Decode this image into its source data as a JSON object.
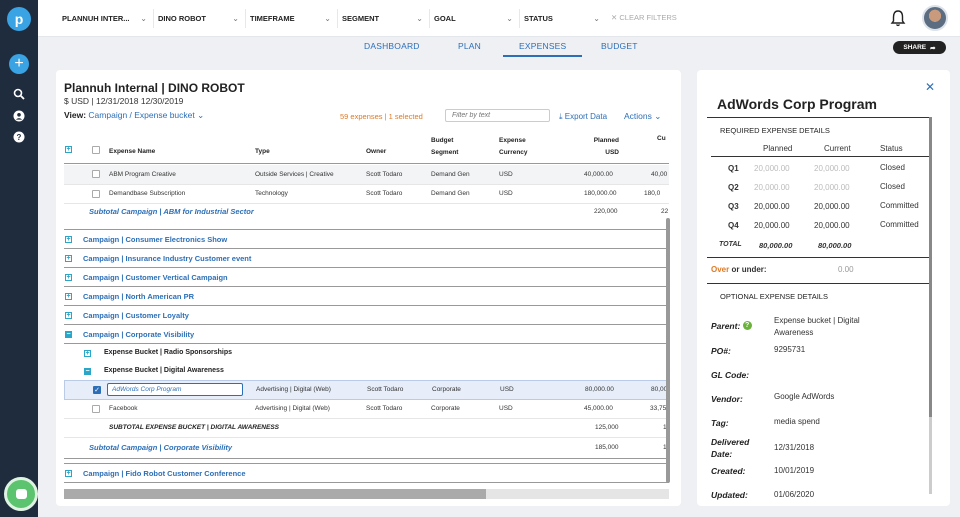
{
  "filters": [
    {
      "label": "PLANNUH INTER..."
    },
    {
      "label": "DINO ROBOT"
    },
    {
      "label": "TIMEFRAME"
    },
    {
      "label": "SEGMENT"
    },
    {
      "label": "GOAL"
    },
    {
      "label": "STATUS"
    }
  ],
  "clear_filters": "✕ CLEAR FILTERS",
  "tabs": [
    "DASHBOARD",
    "PLAN",
    "EXPENSES",
    "BUDGET"
  ],
  "active_tab": "EXPENSES",
  "share": "SHARE",
  "main": {
    "title": "Plannuh Internal | DINO ROBOT",
    "subtitle": "$ USD | 12/31/2018 12/30/2019",
    "view_label": "View:",
    "view_value": "Campaign / Expense bucket",
    "count": "59 expenses | 1 selected",
    "filter_placeholder": "Filter by text",
    "export": "Export Data",
    "actions": "Actions"
  },
  "columns": {
    "name": "Expense Name",
    "type": "Type",
    "owner": "Owner",
    "segment": "Budget Segment",
    "currency": "Expense Currency",
    "planned": "Planned USD",
    "cur": "Cu"
  },
  "rows": {
    "r1": {
      "name": "ABM Program Creative",
      "type": "Outside Services | Creative",
      "owner": "Scott Todaro",
      "segment": "Demand Gen",
      "currency": "USD",
      "planned": "40,000.00",
      "cur": "40,00"
    },
    "r2": {
      "name": "Demandbase Subscription",
      "type": "Technology",
      "owner": "Scott Todaro",
      "segment": "Demand Gen",
      "currency": "USD",
      "planned": "180,000.00",
      "cur": "180,0"
    },
    "sub1": {
      "label": "Subtotal Campaign | ABM for Industrial Sector",
      "planned": "220,000",
      "cur": "22"
    },
    "c1": "Campaign | Consumer Electronics Show",
    "c2": "Campaign | Insurance Industry Customer event",
    "c3": "Campaign | Customer Vertical Campaign",
    "c4": "Campaign | North American PR",
    "c5": "Campaign | Customer Loyalty",
    "c6": "Campaign | Corporate Visibility",
    "b1": "Expense Bucket | Radio Sponsorships",
    "b2": "Expense Bucket | Digital Awareness",
    "r3": {
      "name": "AdWords Corp Program",
      "type": "Advertising | Digital (Web)",
      "owner": "Scott Todaro",
      "segment": "Corporate",
      "currency": "USD",
      "planned": "80,000.00",
      "cur": "80,00"
    },
    "r4": {
      "name": "Facebook",
      "type": "Advertising | Digital (Web)",
      "owner": "Scott Todaro",
      "segment": "Corporate",
      "currency": "USD",
      "planned": "45,000.00",
      "cur": "33,75"
    },
    "bsub": {
      "label": "SUBTOTAL EXPENSE BUCKET | DIGITAL AWARENESS",
      "planned": "125,000",
      "cur": "1"
    },
    "sub2": {
      "label": "Subtotal Campaign | Corporate Visibility",
      "planned": "185,000",
      "cur": "1"
    },
    "c7": "Campaign | Fido Robot Customer Conference"
  },
  "side": {
    "title": "AdWords Corp Program",
    "required": "REQUIRED EXPENSE DETAILS",
    "headers": {
      "planned": "Planned",
      "current": "Current",
      "status": "Status"
    },
    "quarters": [
      {
        "q": "Q1",
        "planned": "20,000.00",
        "current": "20,000.00",
        "status": "Closed"
      },
      {
        "q": "Q2",
        "planned": "20,000.00",
        "current": "20,000.00",
        "status": "Closed"
      },
      {
        "q": "Q3",
        "planned": "20,000.00",
        "current": "20,000.00",
        "status": "Committed"
      },
      {
        "q": "Q4",
        "planned": "20,000.00",
        "current": "20,000.00",
        "status": "Committed"
      }
    ],
    "total": {
      "label": "TOTAL",
      "planned": "80,000.00",
      "current": "80,000.00"
    },
    "over_label": "Over",
    "under_label": "or under:",
    "over_value": "0.00",
    "optional": "OPTIONAL EXPENSE DETAILS",
    "fields": {
      "parent_label": "Parent:",
      "parent_value": "Expense bucket | Digital Awareness",
      "po_label": "PO#:",
      "po_value": "9295731",
      "gl_label": "GL Code:",
      "gl_value": "",
      "vendor_label": "Vendor:",
      "vendor_value": "Google AdWords",
      "tag_label": "Tag:",
      "tag_value": "media spend",
      "delivered_label": "Delivered Date:",
      "delivered_value": "12/31/2018",
      "created_label": "Created:",
      "created_value": "10/01/2019",
      "updated_label": "Updated:",
      "updated_value": "01/06/2020"
    }
  },
  "colors": {
    "accent": "#2d6fb7",
    "rail": "#1f2c3e",
    "orange": "#e07a25",
    "teal": "#2aa6c9"
  }
}
